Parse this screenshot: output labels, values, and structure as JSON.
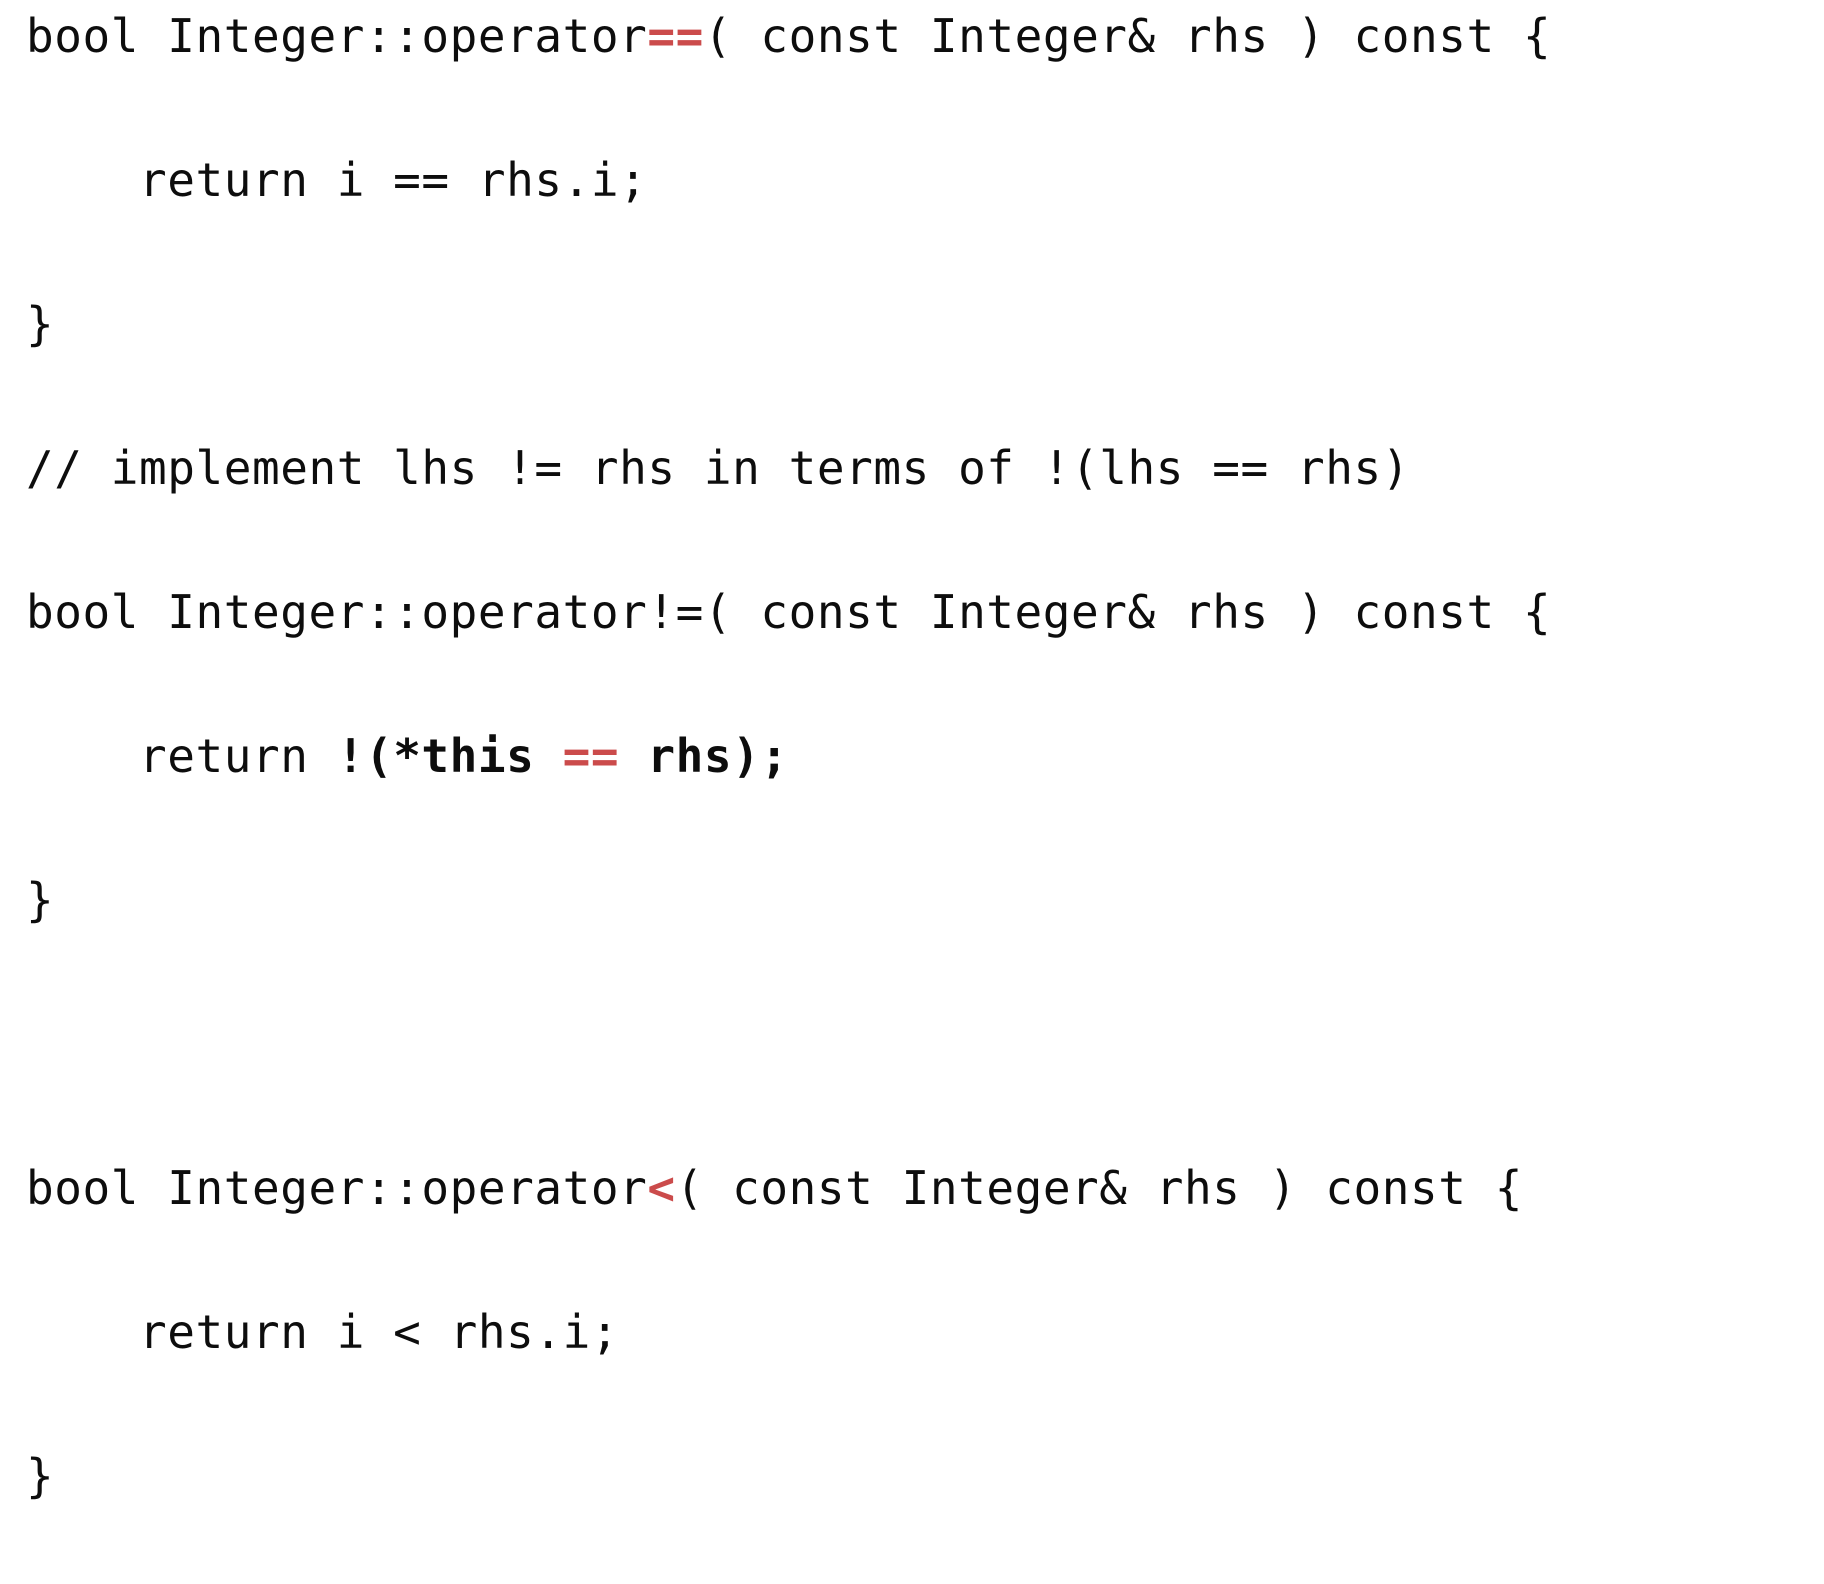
{
  "slide": {
    "kind": "code-listing",
    "language": "cpp",
    "background_color": "#ffffff",
    "text_color": "#0d0d0d",
    "accent_color": "#cb4b4b",
    "font_size_px": 46,
    "line_height_px": 72,
    "indent_spaces": 4
  },
  "code": {
    "full_text": "bool Integer::operator==( const Integer& rhs ) const {\n    return i == rhs.i;\n}\n// implement lhs != rhs in terms of !(lhs == rhs)\nbool Integer::operator!=( const Integer& rhs ) const {\n    return !(*this == rhs);\n}\n\nbool Integer::operator<( const Integer& rhs ) const {\n    return i < rhs.i;\n}",
    "lines": [
      {
        "id": "line-1",
        "text": "bool Integer::operator==( const Integer& rhs ) const {",
        "segments": [
          {
            "text": "bool Integer::operator",
            "style": "plain"
          },
          {
            "text": "==",
            "style": "op-red"
          },
          {
            "text": "( const Integer& rhs ) const {",
            "style": "plain"
          }
        ]
      },
      {
        "id": "line-2",
        "text": "    return i == rhs.i;",
        "segments": [
          {
            "text": "    return i == rhs.i;",
            "style": "plain"
          }
        ]
      },
      {
        "id": "line-3",
        "text": "}",
        "segments": [
          {
            "text": "}",
            "style": "plain"
          }
        ]
      },
      {
        "id": "line-4",
        "text": "// implement lhs != rhs in terms of !(lhs == rhs)",
        "segments": [
          {
            "text": "// implement lhs != rhs in terms of !(lhs == rhs)",
            "style": "plain"
          }
        ]
      },
      {
        "id": "line-5",
        "text": "bool Integer::operator!=( const Integer& rhs ) const {",
        "segments": [
          {
            "text": "bool Integer::operator!=( const Integer& rhs ) const {",
            "style": "plain"
          }
        ]
      },
      {
        "id": "line-6",
        "text": "    return !(*this == rhs);",
        "segments": [
          {
            "text": "    return ",
            "style": "plain"
          },
          {
            "text": "!(*this ",
            "style": "bold"
          },
          {
            "text": "==",
            "style": "bold-red"
          },
          {
            "text": " rhs);",
            "style": "bold"
          }
        ]
      },
      {
        "id": "line-7",
        "text": "}",
        "segments": [
          {
            "text": "}",
            "style": "plain"
          }
        ]
      },
      {
        "id": "line-8",
        "text": "",
        "segments": []
      },
      {
        "id": "line-9",
        "text": "bool Integer::operator<( const Integer& rhs ) const {",
        "segments": [
          {
            "text": "bool Integer::operator",
            "style": "plain"
          },
          {
            "text": "<",
            "style": "bold-red"
          },
          {
            "text": "( const Integer& rhs ) const {",
            "style": "plain"
          }
        ]
      },
      {
        "id": "line-10",
        "text": "    return i < rhs.i;",
        "segments": [
          {
            "text": "    return i < rhs.i;",
            "style": "plain"
          }
        ]
      },
      {
        "id": "line-11",
        "text": "}",
        "segments": [
          {
            "text": "}",
            "style": "plain"
          }
        ]
      }
    ]
  }
}
